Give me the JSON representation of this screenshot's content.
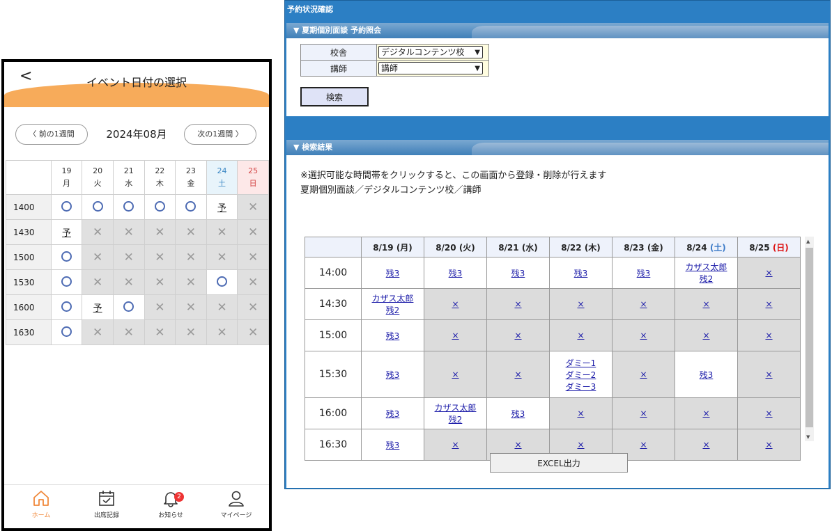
{
  "mobile": {
    "header": {
      "back": "<",
      "title": "イベント日付の選択"
    },
    "nav": {
      "prev": "前の1週間",
      "month": "2024年08月",
      "next": "次の1週間"
    },
    "days": [
      {
        "num": "19",
        "wd": "月",
        "type": "weekday"
      },
      {
        "num": "20",
        "wd": "火",
        "type": "weekday"
      },
      {
        "num": "21",
        "wd": "水",
        "type": "weekday"
      },
      {
        "num": "22",
        "wd": "木",
        "type": "weekday"
      },
      {
        "num": "23",
        "wd": "金",
        "type": "weekday"
      },
      {
        "num": "24",
        "wd": "土",
        "type": "sat"
      },
      {
        "num": "25",
        "wd": "日",
        "type": "sun"
      }
    ],
    "rows": [
      {
        "time": "1400",
        "cells": [
          "o",
          "o",
          "o",
          "o",
          "o",
          "予",
          "x"
        ]
      },
      {
        "time": "1430",
        "cells": [
          "予",
          "x",
          "x",
          "x",
          "x",
          "x",
          "x"
        ]
      },
      {
        "time": "1500",
        "cells": [
          "o",
          "x",
          "x",
          "x",
          "x",
          "x",
          "x"
        ]
      },
      {
        "time": "1530",
        "cells": [
          "o",
          "x",
          "x",
          "x",
          "x",
          "o",
          "x"
        ]
      },
      {
        "time": "1600",
        "cells": [
          "o",
          "予",
          "o",
          "x",
          "x",
          "x",
          "x"
        ]
      },
      {
        "time": "1630",
        "cells": [
          "o",
          "x",
          "x",
          "x",
          "x",
          "x",
          "x"
        ]
      }
    ],
    "footer": {
      "home": "ホーム",
      "attendance": "出席記録",
      "notice": "お知らせ",
      "notice_badge": "2",
      "mypage": "マイページ"
    },
    "accent": "#f7ab5a"
  },
  "desktop": {
    "title": "予約状況確認",
    "section1": "▼ 夏期個別面談 予約照会",
    "form": {
      "school_label": "校舎",
      "school_value": "デジタルコンテンツ校",
      "teacher_label": "講師",
      "teacher_value": "講師",
      "search": "検索"
    },
    "section2": "▼ 検索結果",
    "note1": "※選択可能な時間帯をクリックすると、この画面から登録・削除が行えます",
    "note2": "夏期個別面談／デジタルコンテンツ校／講師",
    "columns": [
      {
        "date": "8/19",
        "wd": "(月)",
        "type": "weekday"
      },
      {
        "date": "8/20",
        "wd": "(火)",
        "type": "weekday"
      },
      {
        "date": "8/21",
        "wd": "(水)",
        "type": "weekday"
      },
      {
        "date": "8/22",
        "wd": "(木)",
        "type": "weekday"
      },
      {
        "date": "8/23",
        "wd": "(金)",
        "type": "weekday"
      },
      {
        "date": "8/24",
        "wd": "(土)",
        "type": "sat"
      },
      {
        "date": "8/25",
        "wd": "(日)",
        "type": "sun"
      }
    ],
    "rows": [
      {
        "time": "14:00",
        "cells": [
          [
            "残3"
          ],
          [
            "残3"
          ],
          [
            "残3"
          ],
          [
            "残3"
          ],
          [
            "残3"
          ],
          [
            "カザス太郎",
            "残2"
          ],
          [
            "×"
          ]
        ],
        "bg": [
          "w",
          "w",
          "w",
          "w",
          "w",
          "w",
          "x"
        ]
      },
      {
        "time": "14:30",
        "cells": [
          [
            "カザス太郎",
            "残2"
          ],
          [
            "×"
          ],
          [
            "×"
          ],
          [
            "×"
          ],
          [
            "×"
          ],
          [
            "×"
          ],
          [
            "×"
          ]
        ],
        "bg": [
          "w",
          "x",
          "x",
          "x",
          "x",
          "x",
          "x"
        ]
      },
      {
        "time": "15:00",
        "cells": [
          [
            "残3"
          ],
          [
            "×"
          ],
          [
            "×"
          ],
          [
            "×"
          ],
          [
            "×"
          ],
          [
            "×"
          ],
          [
            "×"
          ]
        ],
        "bg": [
          "w",
          "x",
          "x",
          "x",
          "x",
          "x",
          "x"
        ]
      },
      {
        "time": "15:30",
        "cells": [
          [
            "残3"
          ],
          [
            "×"
          ],
          [
            "×"
          ],
          [
            "ダミー1",
            "ダミー2",
            "ダミー3"
          ],
          [
            "×"
          ],
          [
            "残3"
          ],
          [
            "×"
          ]
        ],
        "bg": [
          "w",
          "x",
          "x",
          "w",
          "x",
          "w",
          "x"
        ]
      },
      {
        "time": "16:00",
        "cells": [
          [
            "残3"
          ],
          [
            "カザス太郎",
            "残2"
          ],
          [
            "残3"
          ],
          [
            "×"
          ],
          [
            "×"
          ],
          [
            "×"
          ],
          [
            "×"
          ]
        ],
        "bg": [
          "w",
          "w",
          "w",
          "x",
          "x",
          "x",
          "x"
        ]
      },
      {
        "time": "16:30",
        "cells": [
          [
            "残3"
          ],
          [
            "×"
          ],
          [
            "×"
          ],
          [
            "×"
          ],
          [
            "×"
          ],
          [
            "×"
          ],
          [
            "×"
          ]
        ],
        "bg": [
          "w",
          "x",
          "x",
          "x",
          "x",
          "x",
          "x"
        ]
      }
    ],
    "excel": "EXCEL出力",
    "brand": "#2c7fc4"
  }
}
